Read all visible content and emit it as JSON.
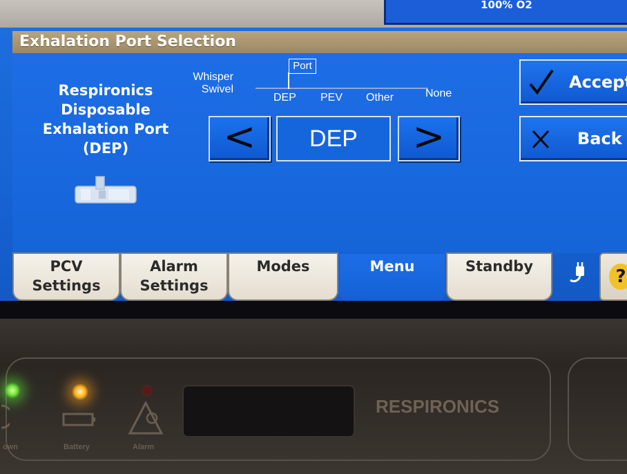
{
  "status_bar": {
    "oxygen": "100% O2"
  },
  "page_title": "Exhalation Port Selection",
  "port_description": {
    "line1": "Respironics",
    "line2": "Disposable",
    "line3": "Exhalation Port",
    "line4": "(DEP)"
  },
  "port_scale": {
    "marker_label": "Port",
    "options": [
      "Whisper\nSwivel",
      "DEP",
      "PEV",
      "Other",
      "None"
    ],
    "whisper_line1": "Whisper",
    "whisper_line2": "Swivel",
    "dep": "DEP",
    "pev": "PEV",
    "other": "Other",
    "none": "None",
    "selected": "DEP"
  },
  "selector": {
    "prev_symbol": "<",
    "value": "DEP",
    "next_symbol": ">"
  },
  "actions": {
    "accept_label": "Accept",
    "back_label": "Back"
  },
  "tabs": [
    {
      "line1": "PCV",
      "line2": "Settings"
    },
    {
      "line1": "Alarm",
      "line2": "Settings"
    },
    {
      "line1": "Modes",
      "line2": ""
    },
    {
      "line1": "Menu",
      "line2": ""
    },
    {
      "line1": "Standby",
      "line2": ""
    }
  ],
  "active_tab": "Menu",
  "help_symbol": "?",
  "bezel": {
    "labels": {
      "power": "own",
      "battery": "Battery",
      "alarm": "Alarm"
    },
    "brand": "RESPIRONICS"
  },
  "colors": {
    "screen_blue": "#1d6de6",
    "title_bar": "#b09c76",
    "tab_inactive": "#f0ebe0",
    "led_green": "#6fe23a",
    "led_amber": "#ffb020",
    "help_yellow": "#f2c12a"
  }
}
